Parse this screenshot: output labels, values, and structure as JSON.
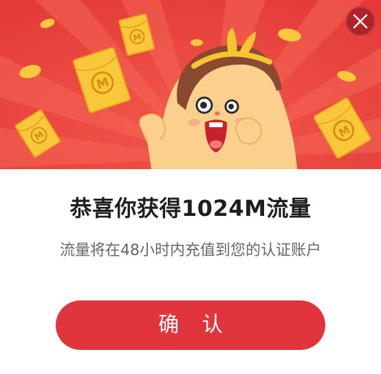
{
  "dialog": {
    "title": "恭喜你获得1024M流量",
    "subtitle": "流量将在48小时内充值到您的认证账户",
    "confirm_label": "确 认",
    "close_icon": "close-icon"
  },
  "banner": {
    "envelope_label": "M",
    "illustration": "cheering-girl-character"
  },
  "colors": {
    "banner_red": "#e8403f",
    "ray_red": "#f05a4a",
    "button_red": "#e0353d",
    "envelope_gold": "#f9c73a",
    "title_text": "#1e1e1e",
    "subtitle_text": "#666666"
  }
}
